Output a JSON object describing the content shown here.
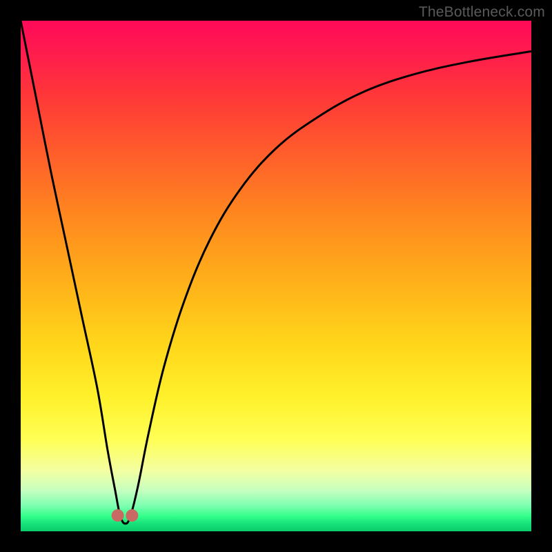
{
  "watermark": "TheBottleneck.com",
  "chart_data": {
    "type": "line",
    "title": "",
    "xlabel": "",
    "ylabel": "",
    "xlim": [
      0,
      100
    ],
    "ylim": [
      0,
      100
    ],
    "grid": false,
    "series": [
      {
        "name": "curve",
        "x": [
          0,
          3,
          6,
          9,
          12,
          15,
          17,
          18.5,
          19.5,
          20.5,
          21.5,
          23,
          25,
          28,
          32,
          37,
          43,
          50,
          58,
          67,
          77,
          88,
          100
        ],
        "y": [
          100,
          85,
          70,
          56,
          42,
          28,
          16,
          8,
          3,
          1.5,
          3,
          9,
          19,
          32,
          45,
          57,
          67,
          75,
          81,
          86,
          89.5,
          92,
          94
        ]
      }
    ],
    "markers": [
      {
        "name": "valley-left",
        "x": 19.0,
        "y": 3.1
      },
      {
        "name": "valley-right",
        "x": 21.8,
        "y": 3.1
      }
    ],
    "marker_color": "#c86a63",
    "marker_radius_px": 9,
    "curve_stroke": "#000000",
    "curve_stroke_width_px": 3
  }
}
